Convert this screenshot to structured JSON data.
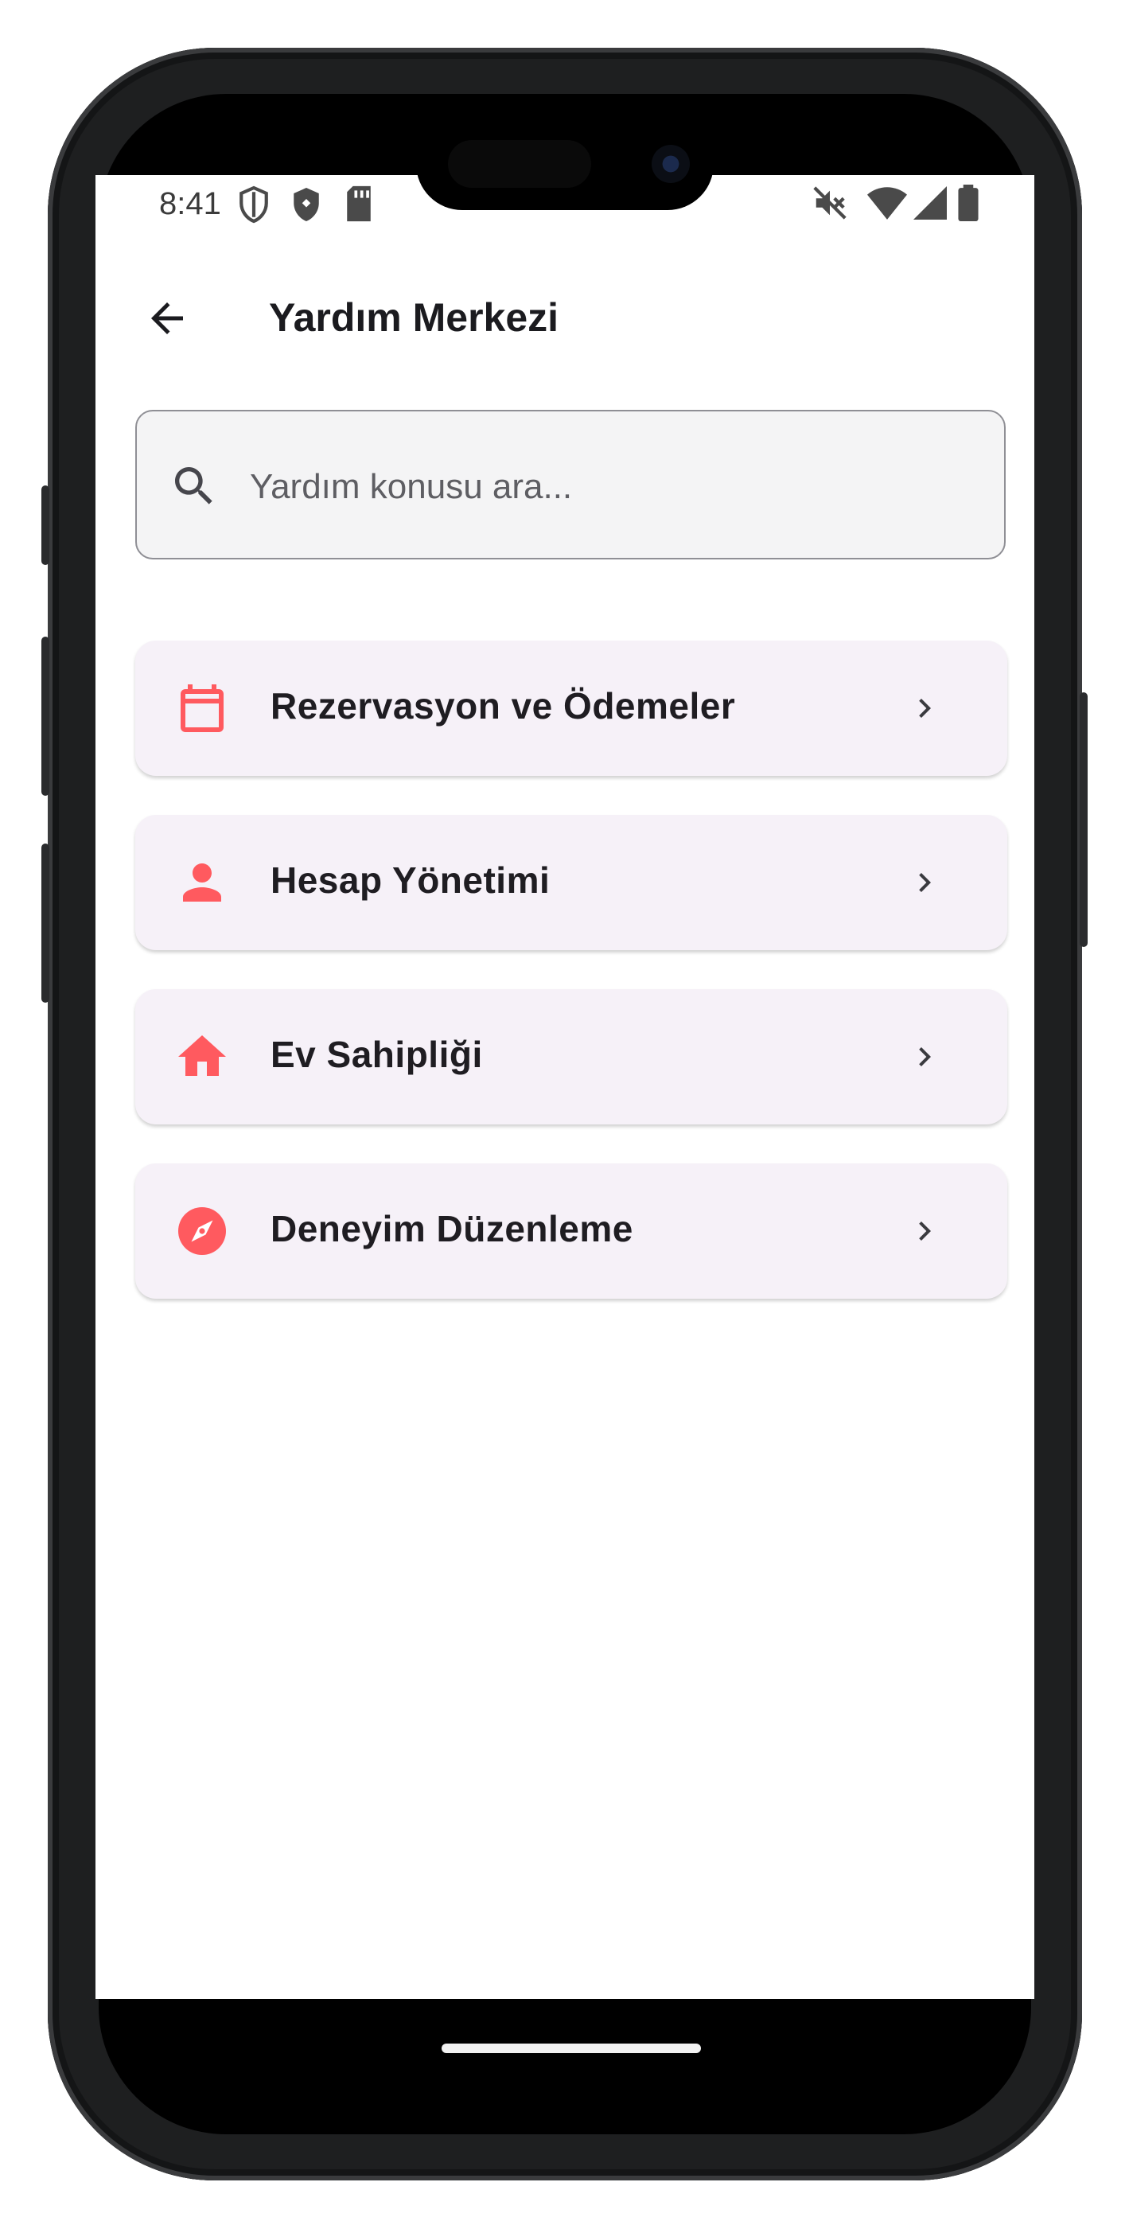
{
  "status_bar": {
    "time": "8:41",
    "icons": [
      "shield-outline-icon",
      "shield-filled-icon",
      "sd-card-icon",
      "mute-icon",
      "wifi-icon",
      "signal-icon",
      "battery-icon"
    ]
  },
  "app_bar": {
    "title": "Yardım Merkezi",
    "back_icon": "arrow-back-icon"
  },
  "search": {
    "placeholder": "Yardım konusu ara...",
    "value": "",
    "icon": "search-icon"
  },
  "help_topics": [
    {
      "label": "Rezervasyon ve Ödemeler",
      "icon": "calendar-icon"
    },
    {
      "label": "Hesap Yönetimi",
      "icon": "person-icon"
    },
    {
      "label": "Ev Sahipliği",
      "icon": "home-icon"
    },
    {
      "label": "Deneyim Düzenleme",
      "icon": "compass-icon"
    }
  ],
  "colors": {
    "accent": "#FF5A5F",
    "card_bg": "#F6F1F8",
    "title": "#1B1B1F"
  }
}
